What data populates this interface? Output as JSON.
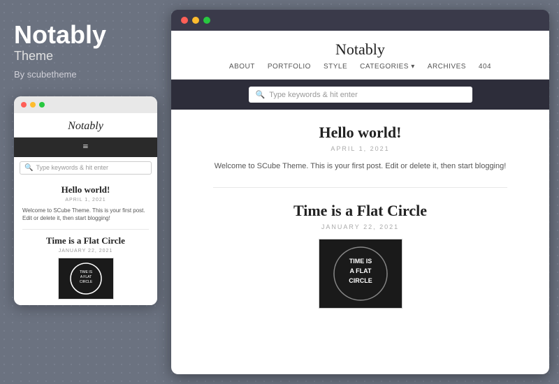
{
  "left": {
    "title": "Notably",
    "subtitle": "Theme",
    "author": "By scubetheme"
  },
  "mobile": {
    "titlebar_dots": [
      "red",
      "yellow",
      "green"
    ],
    "blog_title": "Notably",
    "nav_icon": "≡",
    "search_placeholder": "Type keywords & hit enter",
    "posts": [
      {
        "title": "Hello world!",
        "date": "APRIL 1, 2021",
        "excerpt": "Welcome to SCube Theme. This is your first post. Edit or delete it, then start blogging!"
      },
      {
        "title": "Time is a Flat Circle",
        "date": "JANUARY 22, 2021",
        "has_thumbnail": true
      }
    ]
  },
  "desktop": {
    "titlebar_dots": [
      "red",
      "yellow",
      "green"
    ],
    "blog_title": "Notably",
    "nav_items": [
      "ABOUT",
      "PORTFOLIO",
      "STYLE",
      "CATEGORIES ▾",
      "ARCHIVES",
      "404"
    ],
    "search_placeholder": "Type keywords & hit enter",
    "posts": [
      {
        "title": "Hello world!",
        "date": "APRIL 1, 2021",
        "excerpt": "Welcome to SCube Theme. This is your first post. Edit or delete it, then start blogging!"
      },
      {
        "title": "Time is a Flat Circle",
        "date": "JANUARY 22, 2021",
        "has_thumbnail": true
      }
    ]
  }
}
